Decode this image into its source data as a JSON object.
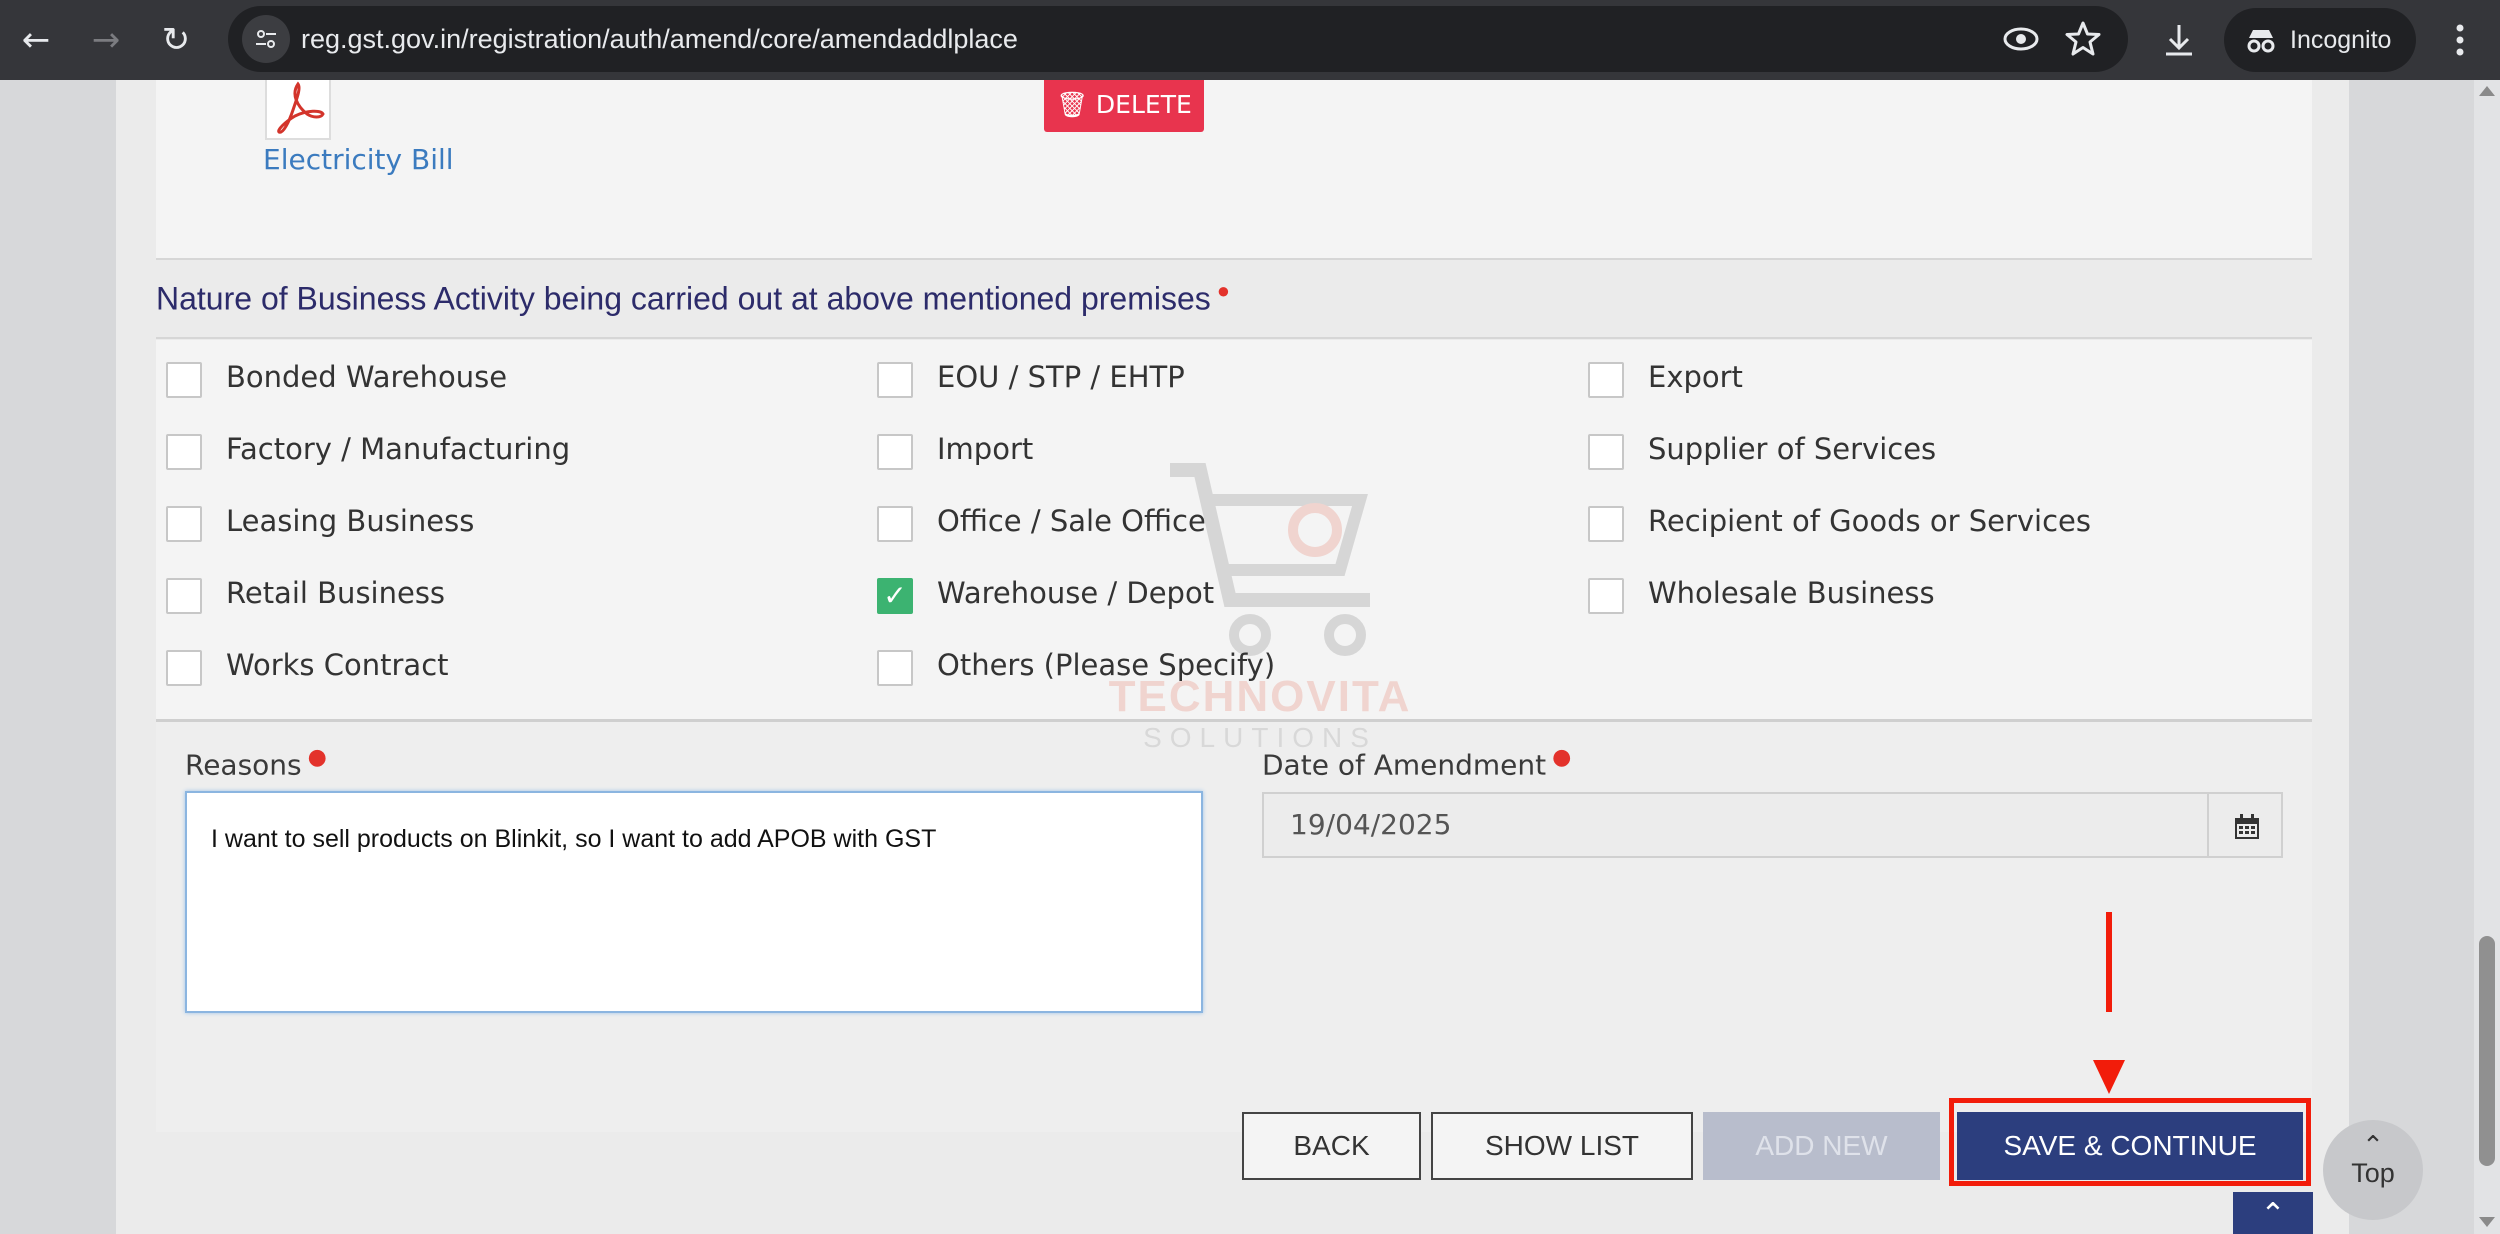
{
  "browser": {
    "url": "reg.gst.gov.in/registration/auth/amend/core/amendaddlplace",
    "incognito_label": "Incognito"
  },
  "document": {
    "name": "Electricity Bill",
    "delete_label": "DELETE"
  },
  "business_activity": {
    "title": "Nature of Business Activity being carried out at above mentioned premises",
    "options": [
      {
        "label": "Bonded Warehouse",
        "checked": false
      },
      {
        "label": "EOU / STP / EHTP",
        "checked": false
      },
      {
        "label": "Export",
        "checked": false
      },
      {
        "label": "Factory / Manufacturing",
        "checked": false
      },
      {
        "label": "Import",
        "checked": false
      },
      {
        "label": "Supplier of Services",
        "checked": false
      },
      {
        "label": "Leasing Business",
        "checked": false
      },
      {
        "label": "Office / Sale Office",
        "checked": false
      },
      {
        "label": "Recipient of Goods or Services",
        "checked": false
      },
      {
        "label": "Retail Business",
        "checked": false
      },
      {
        "label": "Warehouse / Depot",
        "checked": true
      },
      {
        "label": "Wholesale Business",
        "checked": false
      },
      {
        "label": "Works Contract",
        "checked": false
      },
      {
        "label": "Others (Please Specify)",
        "checked": false
      }
    ]
  },
  "reasons": {
    "label": "Reasons",
    "value": "I want to sell products on Blinkit, so I want to add APOB with GST"
  },
  "amendment_date": {
    "label": "Date of Amendment",
    "value": "19/04/2025"
  },
  "actions": {
    "back": "BACK",
    "show_list": "SHOW LIST",
    "add_new": "ADD NEW",
    "save_continue": "SAVE & CONTINUE",
    "top": "Top"
  },
  "watermark": {
    "title": "TECHNOVITA",
    "subtitle": "SOLUTIONS"
  },
  "colors": {
    "primary": "#2c3e7e",
    "danger": "#e8344e",
    "checked": "#3cb371",
    "highlight": "#f21c0a"
  }
}
